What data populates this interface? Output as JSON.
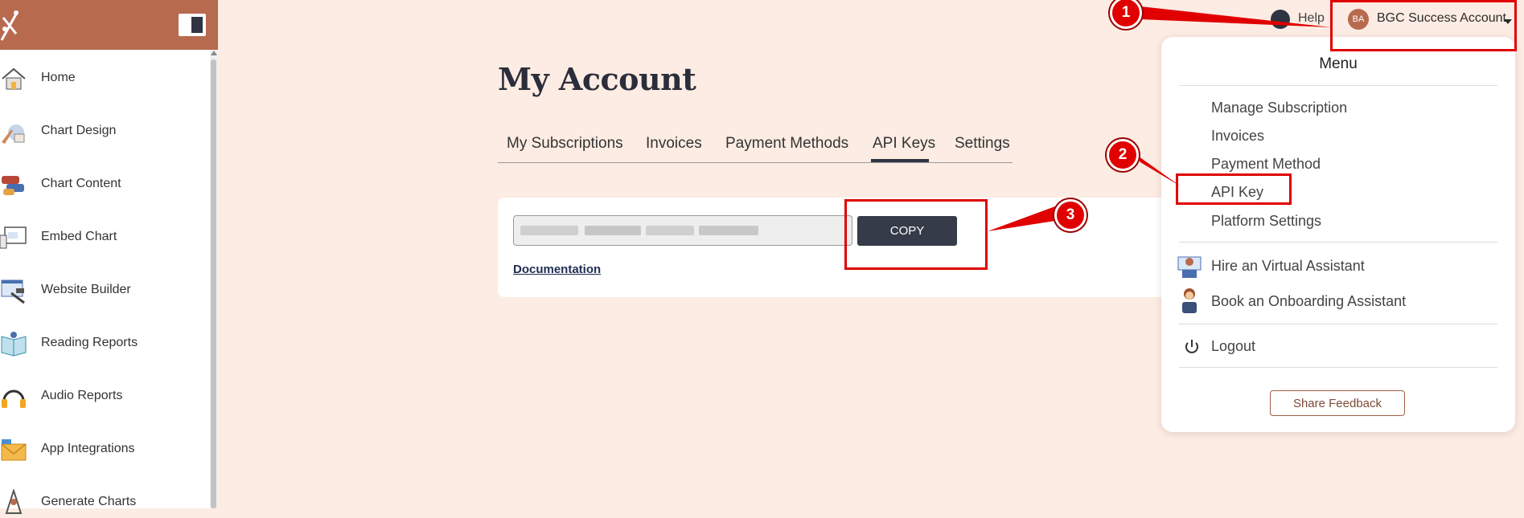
{
  "header": {
    "help_label": "Help",
    "avatar_initials": "BA",
    "account_name": "BGC Success Account"
  },
  "sidebar": {
    "items": [
      {
        "label": "Home",
        "icon": "house-icon"
      },
      {
        "label": "Chart Design",
        "icon": "chart-design-icon"
      },
      {
        "label": "Chart Content",
        "icon": "chart-content-icon"
      },
      {
        "label": "Embed Chart",
        "icon": "embed-chart-icon"
      },
      {
        "label": "Website Builder",
        "icon": "website-builder-icon"
      },
      {
        "label": "Reading Reports",
        "icon": "reading-reports-icon"
      },
      {
        "label": "Audio Reports",
        "icon": "headphones-icon"
      },
      {
        "label": "App Integrations",
        "icon": "envelope-icon"
      },
      {
        "label": "Generate Charts",
        "icon": "generate-charts-icon"
      }
    ]
  },
  "main": {
    "title": "My Account",
    "tabs": [
      {
        "label": "My Subscriptions"
      },
      {
        "label": "Invoices"
      },
      {
        "label": "Payment Methods"
      },
      {
        "label": "API Keys",
        "active": true
      },
      {
        "label": "Settings"
      }
    ],
    "api_key": {
      "copy_label": "COPY",
      "documentation_label": "Documentation"
    }
  },
  "menu": {
    "title": "Menu",
    "items": [
      {
        "label": "Manage Subscription"
      },
      {
        "label": "Invoices"
      },
      {
        "label": "Payment Method"
      },
      {
        "label": "API Key"
      },
      {
        "label": "Platform Settings"
      }
    ],
    "assistants": [
      {
        "label": "Hire an Virtual Assistant",
        "icon": "virtual-assistant-icon"
      },
      {
        "label": "Book an Onboarding Assistant",
        "icon": "onboarding-assistant-icon"
      }
    ],
    "logout_label": "Logout",
    "feedback_label": "Share Feedback"
  },
  "annotations": {
    "steps": [
      "1",
      "2",
      "3"
    ],
    "color": "#e00000"
  },
  "colors": {
    "brand": "#b86a4f",
    "background": "#fcece3",
    "dark": "#2e3442"
  }
}
